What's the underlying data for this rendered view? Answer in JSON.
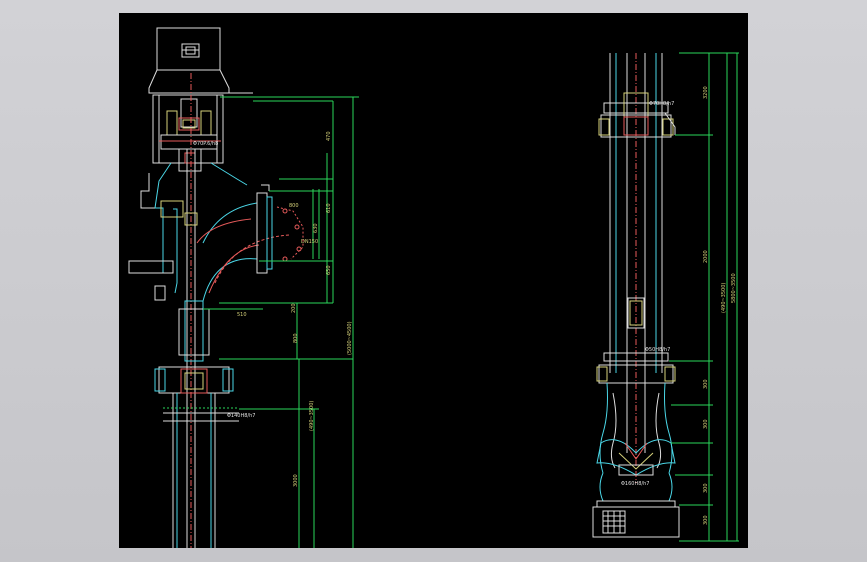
{
  "drawing": {
    "left_view": {
      "dims_right": [
        "470",
        "610",
        "650",
        "200",
        "800",
        "(490~3500)",
        "3000",
        "(5000~4500)"
      ],
      "dims_mid": [
        "DN150",
        "630",
        "800"
      ],
      "dim_bottom": "510",
      "fit_labels": [
        "Φ70P.6/h8",
        "Φ140H8/h7"
      ]
    },
    "right_view": {
      "dims_right": [
        "3200",
        "2000",
        "300",
        "300",
        "300",
        "300"
      ],
      "dims_long": [
        "(490~3500)",
        "5800~3500"
      ],
      "fit_labels": [
        "Φ70H8/h7",
        "Φ50H8/h7",
        "Φ160H8/h7"
      ]
    }
  }
}
